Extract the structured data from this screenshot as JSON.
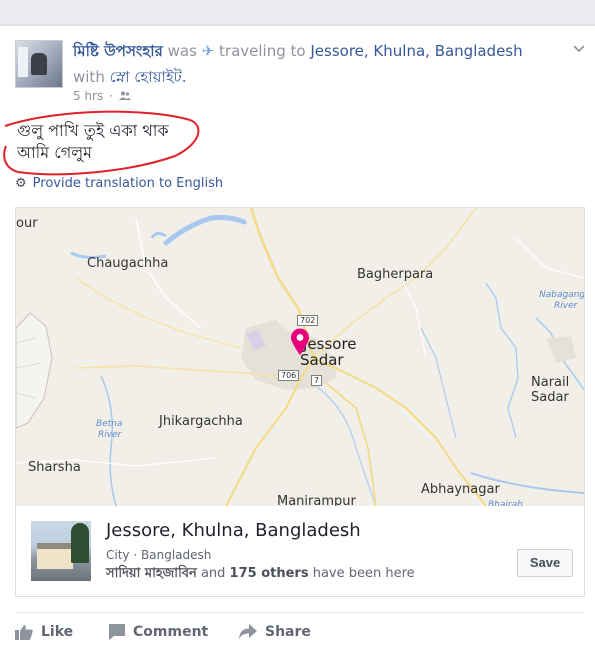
{
  "post": {
    "author": "মিষ্টি উপসংহার",
    "was": "was",
    "activity": "traveling to",
    "location": "Jessore, Khulna, Bangladesh",
    "with_label": "with",
    "tagged": "স্নো হোয়াইট.",
    "time": "5 hrs",
    "text_line1": "গুলু পাখি তুই একা থাক",
    "text_line2": "আমি গেলুম",
    "translate_link": "Provide translation to English",
    "icons": [
      "plane-icon",
      "friends-icon",
      "gear-icon",
      "chevron-down-icon"
    ]
  },
  "map": {
    "labels": {
      "chaugachha": "Chaugachha",
      "bagherpara": "Bagherpara",
      "jessore": "Jessore",
      "sadar": "Sadar",
      "jhikargachha": "Jhikargachha",
      "sharsha": "Sharsha",
      "narail": "Narail",
      "narail_sadar": "Sadar",
      "abhaynagar": "Abhaynagar",
      "manirampur": "Manirampur",
      "our": "our"
    },
    "rivers": {
      "nabaganga1": "Nabagang",
      "nabaganga2": "River",
      "betna1": "Betna",
      "betna2": "River",
      "bhairab": "Bhairab"
    },
    "roads": {
      "r702": "702",
      "r706": "706",
      "r7": "7"
    },
    "pin_color": "#e6007e"
  },
  "place": {
    "title": "Jessore, Khulna, Bangladesh",
    "category": "City",
    "separator": "·",
    "country": "Bangladesh",
    "visitor": "সাদিয়া মাহজাবিন",
    "and": "and",
    "others": "175 others",
    "visited_suffix": "have been here",
    "save_label": "Save"
  },
  "actions": {
    "like": "Like",
    "comment": "Comment",
    "share": "Share"
  },
  "colors": {
    "link": "#365899",
    "annotation": "#e0202a",
    "muted": "#90949c"
  }
}
